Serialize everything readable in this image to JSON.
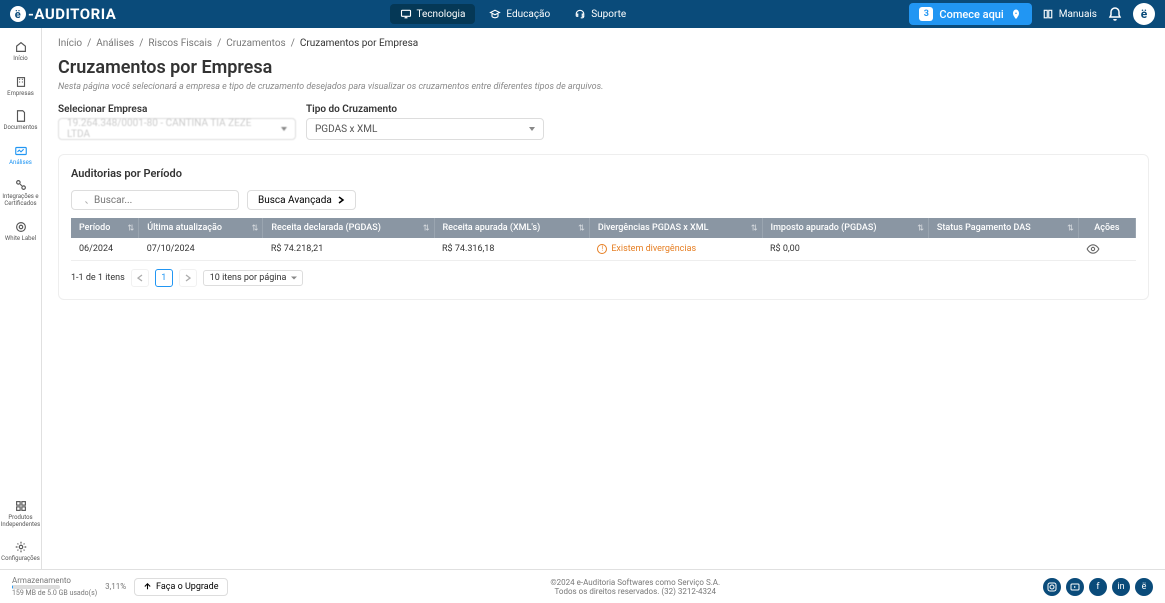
{
  "header": {
    "logo_text": "-AUDITORIA",
    "nav": [
      {
        "label": "Tecnologia",
        "active": true
      },
      {
        "label": "Educação",
        "active": false
      },
      {
        "label": "Suporte",
        "active": false
      }
    ],
    "start_step": "3",
    "start_label": "Comece aqui",
    "manuals_label": "Manuais"
  },
  "sidebar": {
    "items": [
      {
        "label": "Início",
        "icon": "home"
      },
      {
        "label": "Empresas",
        "icon": "building"
      },
      {
        "label": "Documentos",
        "icon": "document"
      },
      {
        "label": "Análises",
        "icon": "analysis",
        "active": true
      },
      {
        "label": "Integrações e Certificados",
        "icon": "integrations"
      },
      {
        "label": "White Label",
        "icon": "whitelabel"
      }
    ],
    "bottom_items": [
      {
        "label": "Produtos Independentes",
        "icon": "products"
      },
      {
        "label": "Configurações",
        "icon": "settings"
      }
    ]
  },
  "breadcrumb": [
    "Início",
    "Análises",
    "Riscos Fiscais",
    "Cruzamentos",
    "Cruzamentos por Empresa"
  ],
  "page": {
    "title": "Cruzamentos por Empresa",
    "desc": "Nesta página você selecionará a empresa e tipo de cruzamento desejados para visualizar os cruzamentos entre diferentes tipos de arquivos."
  },
  "filters": {
    "company_label": "Selecionar Empresa",
    "company_value": "19.264.348/0001-80 - CANTINA TIA ZEZE LTDA",
    "type_label": "Tipo do Cruzamento",
    "type_value": "PGDAS x XML"
  },
  "panel": {
    "title": "Auditorias por Período",
    "search_placeholder": "Buscar...",
    "advanced_label": "Busca Avançada",
    "columns": [
      "Período",
      "Última atualização",
      "Receita declarada (PGDAS)",
      "Receita apurada (XML's)",
      "Divergências PGDAS x XML",
      "Imposto apurado (PGDAS)",
      "Status Pagamento DAS",
      "Ações"
    ],
    "rows": [
      {
        "periodo": "06/2024",
        "ultima_atualizacao": "07/10/2024",
        "receita_declarada": "R$ 74.218,21",
        "receita_apurada": "R$ 74.316,18",
        "divergencias": "Existem divergências",
        "imposto_apurado": "R$ 0,00",
        "status_das": ""
      }
    ],
    "pagination": {
      "summary": "1-1 de 1 itens",
      "current": "1",
      "page_size": "10 itens por página"
    }
  },
  "footer": {
    "storage_label": "Armazenamento",
    "storage_detail": "159 MB de 5.0 GB usado(s)",
    "storage_pct": "3,11%",
    "upgrade_label": "Faça o Upgrade",
    "copyright": "©2024 e-Auditoria Softwares como Serviço S.A.",
    "rights": "Todos os direitos reservados. (32) 3212-4324"
  }
}
